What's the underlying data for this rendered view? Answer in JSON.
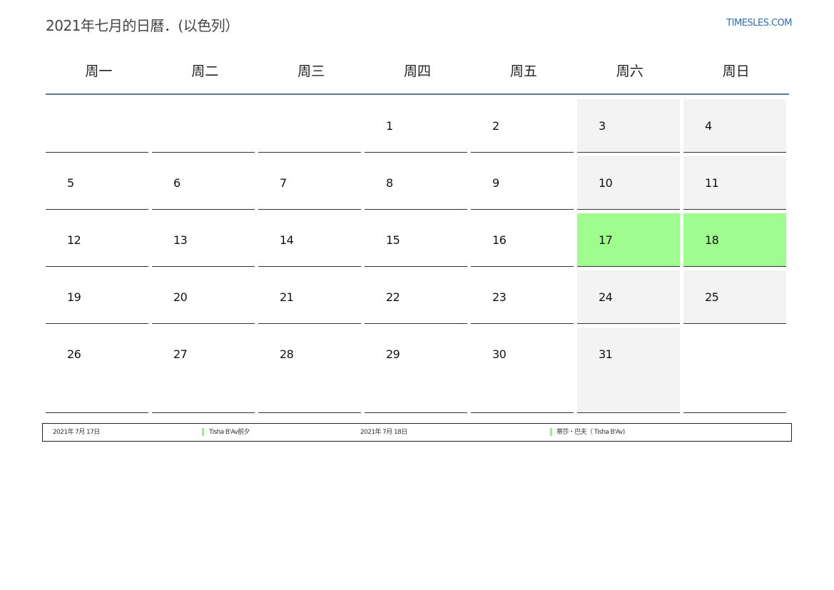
{
  "title": "2021年七月的日曆．(以色列）",
  "site": "TIMESLES.COM",
  "weekdays": [
    "周一",
    "周二",
    "周三",
    "周四",
    "周五",
    "周六",
    "周日"
  ],
  "colors": {
    "holiday": "#9efd8e",
    "weekend": "#f3f3f3",
    "accent_link": "#2f6fb5",
    "header_rule": "#5b7796"
  },
  "weeks": [
    [
      "",
      "",
      "",
      "1",
      "2",
      "3",
      "4"
    ],
    [
      "5",
      "6",
      "7",
      "8",
      "9",
      "10",
      "11"
    ],
    [
      "12",
      "13",
      "14",
      "15",
      "16",
      "17",
      "18"
    ],
    [
      "19",
      "20",
      "21",
      "22",
      "23",
      "24",
      "25"
    ],
    [
      "26",
      "27",
      "28",
      "29",
      "30",
      "31",
      ""
    ]
  ],
  "holiday_days": [
    "17",
    "18"
  ],
  "legend": [
    {
      "date": "2021年 7月 17日",
      "name": "Tisha B'Av前夕"
    },
    {
      "date": "2021年 7月 18日",
      "name": "蒂莎・巴夫（ Tisha B'Av)"
    }
  ]
}
